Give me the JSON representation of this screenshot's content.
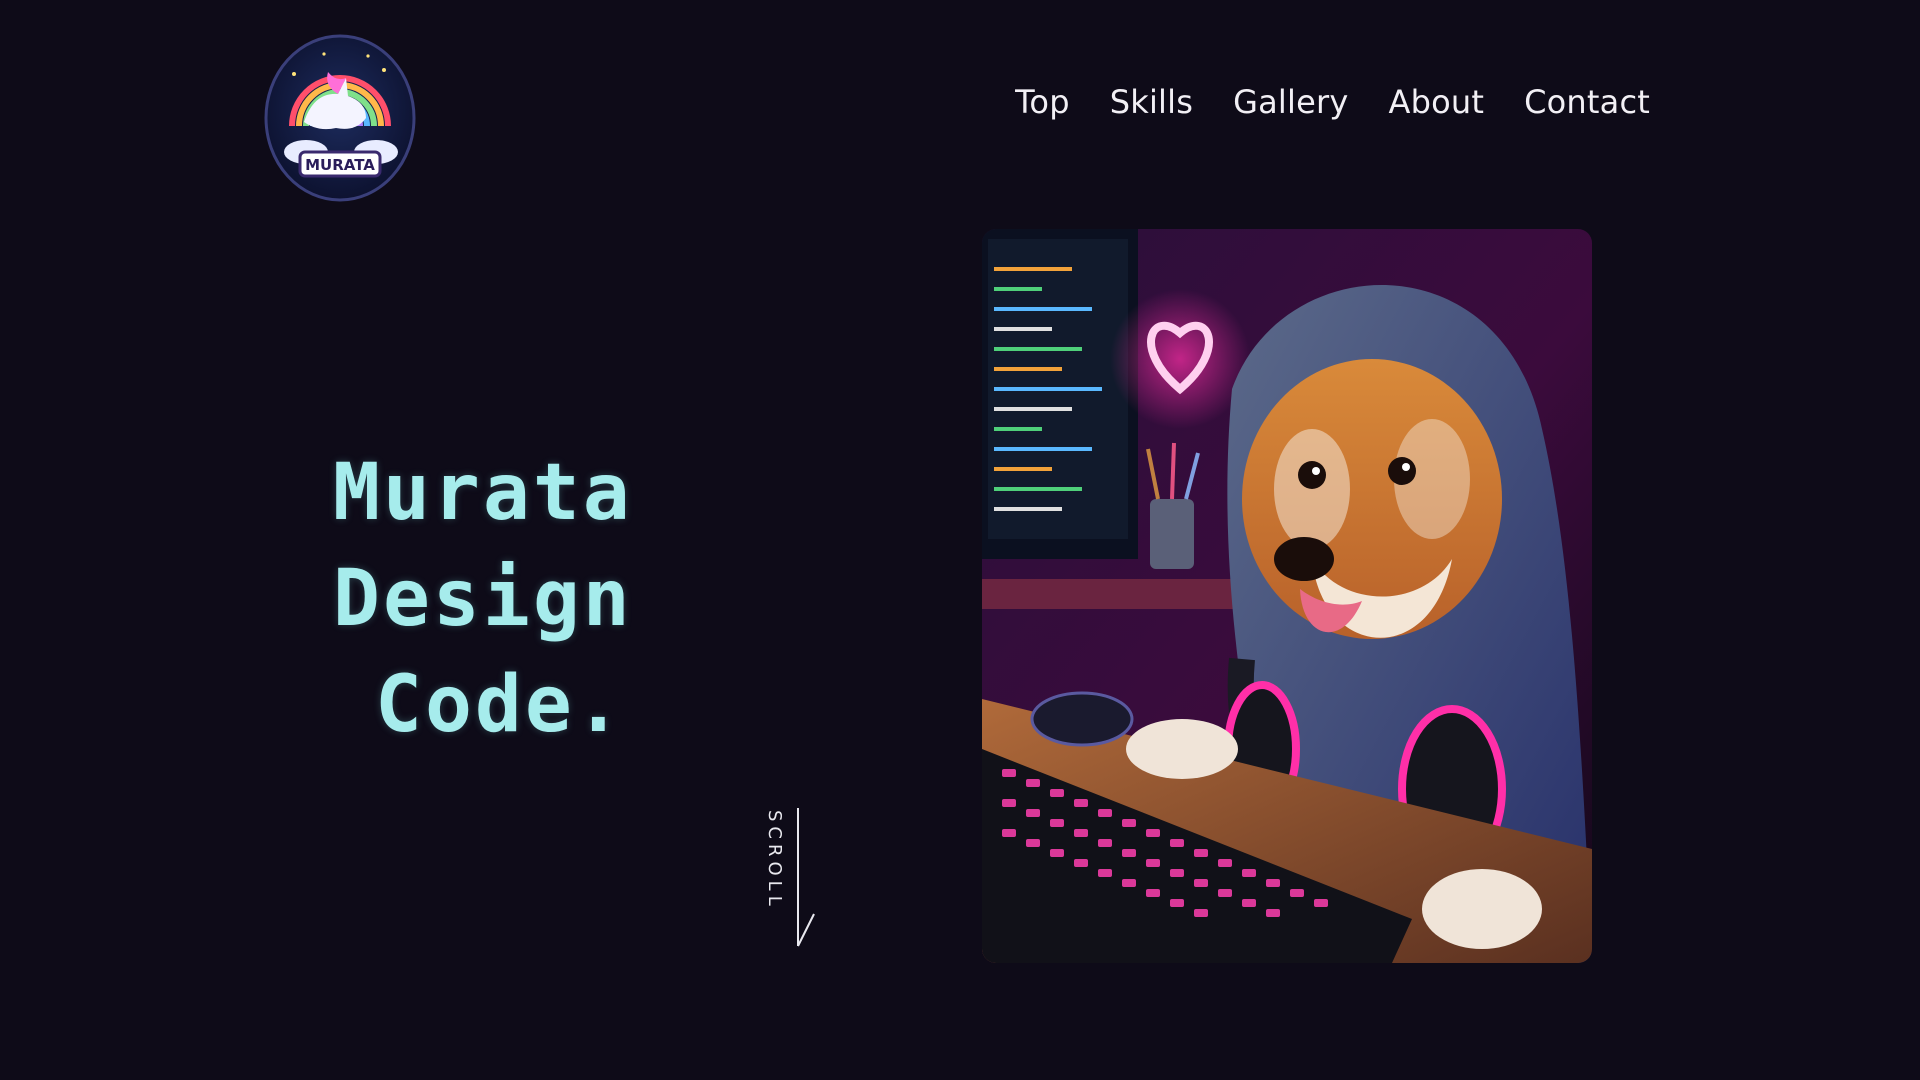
{
  "logo": {
    "text": "MURATA",
    "icon": "unicorn-rainbow-logo-icon"
  },
  "nav": {
    "items": [
      {
        "label": "Top"
      },
      {
        "label": "Skills"
      },
      {
        "label": "Gallery"
      },
      {
        "label": "About"
      },
      {
        "label": "Contact"
      }
    ]
  },
  "hero": {
    "title_lines": [
      "Murata",
      "Design",
      "Code."
    ],
    "scroll_label": "SCROLL",
    "image_icon": "shiba-dog-coder-illustration-icon"
  },
  "colors": {
    "background": "#0e0b18",
    "title": "#a6ecec",
    "nav_text": "#f2f0f5",
    "neon_pink": "#ff2fa8"
  }
}
